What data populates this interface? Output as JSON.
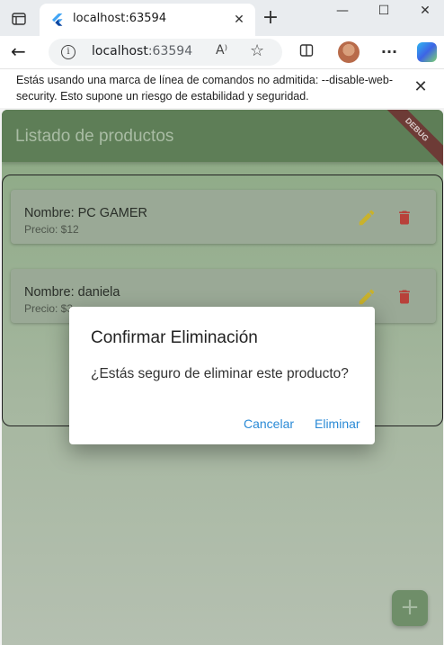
{
  "browser": {
    "tab": {
      "title": "localhost:63594"
    },
    "address": {
      "host": "localhost",
      "port": ":63594"
    },
    "warning": {
      "text": "Estás usando una marca de línea de comandos no admitida: --disable-web-security. Esto supone un riesgo de estabilidad y seguridad."
    }
  },
  "app": {
    "title": "Listado de productos",
    "debug_banner": "DEBUG",
    "products": [
      {
        "name": "Nombre: PC GAMER",
        "price": "Precio: $12"
      },
      {
        "name": "Nombre: daniela",
        "price": "Precio: $3"
      }
    ],
    "fab_label": "+"
  },
  "dialog": {
    "title": "Confirmar Eliminación",
    "message": "¿Estás seguro de eliminar este producto?",
    "cancel_label": "Cancelar",
    "confirm_label": "Eliminar"
  },
  "colors": {
    "appbar": "#5e7e57",
    "accent": "#2a8ad6",
    "edit_icon": "#c9b22c",
    "delete_icon": "#b8413a"
  }
}
